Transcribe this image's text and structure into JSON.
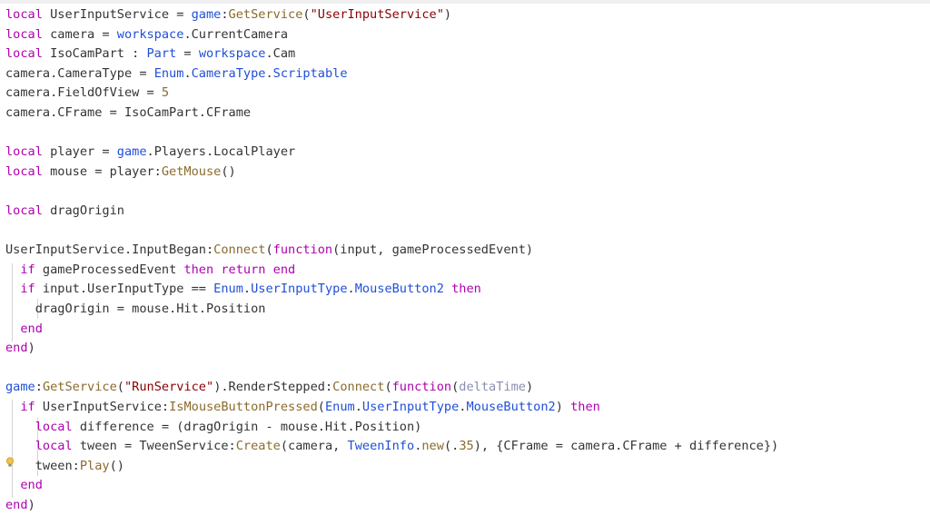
{
  "editor": {
    "language": "lua",
    "colors": {
      "keyword": "#b000b0",
      "builtin": "#1f4fd8",
      "method": "#8a6a2c",
      "string": "#8a0000",
      "number": "#8a6a2c",
      "param": "#8a8fb0",
      "plain": "#333333"
    },
    "lightbulb_icon": "lightbulb-icon",
    "lines": [
      [
        [
          "keyword",
          "local"
        ],
        [
          "plain",
          " UserInputService = "
        ],
        [
          "builtin",
          "game"
        ],
        [
          "plain",
          ":"
        ],
        [
          "method",
          "GetService"
        ],
        [
          "plain",
          "("
        ],
        [
          "string",
          "\"UserInputService\""
        ],
        [
          "plain",
          ")"
        ]
      ],
      [
        [
          "keyword",
          "local"
        ],
        [
          "plain",
          " camera = "
        ],
        [
          "builtin",
          "workspace"
        ],
        [
          "plain",
          ".CurrentCamera"
        ]
      ],
      [
        [
          "keyword",
          "local"
        ],
        [
          "plain",
          " IsoCamPart : "
        ],
        [
          "builtin",
          "Part"
        ],
        [
          "plain",
          " = "
        ],
        [
          "builtin",
          "workspace"
        ],
        [
          "plain",
          ".Cam"
        ]
      ],
      [
        [
          "plain",
          "camera.CameraType = "
        ],
        [
          "builtin",
          "Enum"
        ],
        [
          "plain",
          "."
        ],
        [
          "builtin",
          "CameraType"
        ],
        [
          "plain",
          "."
        ],
        [
          "builtin",
          "Scriptable"
        ]
      ],
      [
        [
          "plain",
          "camera.FieldOfView = "
        ],
        [
          "number",
          "5"
        ]
      ],
      [
        [
          "plain",
          "camera.CFrame = IsoCamPart.CFrame"
        ]
      ],
      [],
      [
        [
          "keyword",
          "local"
        ],
        [
          "plain",
          " player = "
        ],
        [
          "builtin",
          "game"
        ],
        [
          "plain",
          ".Players.LocalPlayer"
        ]
      ],
      [
        [
          "keyword",
          "local"
        ],
        [
          "plain",
          " mouse = player:"
        ],
        [
          "method",
          "GetMouse"
        ],
        [
          "plain",
          "()"
        ]
      ],
      [],
      [
        [
          "keyword",
          "local"
        ],
        [
          "plain",
          " dragOrigin"
        ]
      ],
      [],
      [
        [
          "plain",
          "UserInputService.InputBegan:"
        ],
        [
          "method",
          "Connect"
        ],
        [
          "plain",
          "("
        ],
        [
          "keyword",
          "function"
        ],
        [
          "plain",
          "(input, gameProcessedEvent)"
        ]
      ],
      [
        [
          "plain",
          "  "
        ],
        [
          "keyword",
          "if"
        ],
        [
          "plain",
          " gameProcessedEvent "
        ],
        [
          "keyword",
          "then"
        ],
        [
          "plain",
          " "
        ],
        [
          "keyword",
          "return"
        ],
        [
          "plain",
          " "
        ],
        [
          "keyword",
          "end"
        ]
      ],
      [
        [
          "plain",
          "  "
        ],
        [
          "keyword",
          "if"
        ],
        [
          "plain",
          " input.UserInputType == "
        ],
        [
          "builtin",
          "Enum"
        ],
        [
          "plain",
          "."
        ],
        [
          "builtin",
          "UserInputType"
        ],
        [
          "plain",
          "."
        ],
        [
          "builtin",
          "MouseButton2"
        ],
        [
          "plain",
          " "
        ],
        [
          "keyword",
          "then"
        ]
      ],
      [
        [
          "plain",
          "    dragOrigin = mouse.Hit.Position"
        ]
      ],
      [
        [
          "plain",
          "  "
        ],
        [
          "keyword",
          "end"
        ]
      ],
      [
        [
          "keyword",
          "end"
        ],
        [
          "plain",
          ")"
        ]
      ],
      [],
      [
        [
          "builtin",
          "game"
        ],
        [
          "plain",
          ":"
        ],
        [
          "method",
          "GetService"
        ],
        [
          "plain",
          "("
        ],
        [
          "string",
          "\"RunService\""
        ],
        [
          "plain",
          ").RenderStepped:"
        ],
        [
          "method",
          "Connect"
        ],
        [
          "plain",
          "("
        ],
        [
          "keyword",
          "function"
        ],
        [
          "plain",
          "("
        ],
        [
          "param",
          "deltaTime"
        ],
        [
          "plain",
          ")"
        ]
      ],
      [
        [
          "plain",
          "  "
        ],
        [
          "keyword",
          "if"
        ],
        [
          "plain",
          " UserInputService:"
        ],
        [
          "method",
          "IsMouseButtonPressed"
        ],
        [
          "plain",
          "("
        ],
        [
          "builtin",
          "Enum"
        ],
        [
          "plain",
          "."
        ],
        [
          "builtin",
          "UserInputType"
        ],
        [
          "plain",
          "."
        ],
        [
          "builtin",
          "MouseButton2"
        ],
        [
          "plain",
          ") "
        ],
        [
          "keyword",
          "then"
        ]
      ],
      [
        [
          "plain",
          "    "
        ],
        [
          "keyword",
          "local"
        ],
        [
          "plain",
          " difference = (dragOrigin - mouse.Hit.Position)"
        ]
      ],
      [
        [
          "plain",
          "    "
        ],
        [
          "keyword",
          "local"
        ],
        [
          "plain",
          " tween = TweenService:"
        ],
        [
          "method",
          "Create"
        ],
        [
          "plain",
          "(camera, "
        ],
        [
          "builtin",
          "TweenInfo"
        ],
        [
          "plain",
          "."
        ],
        [
          "method",
          "new"
        ],
        [
          "plain",
          "(."
        ],
        [
          "number",
          "35"
        ],
        [
          "plain",
          "), {CFrame = camera.CFrame + difference})"
        ]
      ],
      [
        [
          "plain",
          "    tween:"
        ],
        [
          "method",
          "Play"
        ],
        [
          "plain",
          "()"
        ]
      ],
      [
        [
          "plain",
          "  "
        ],
        [
          "keyword",
          "end"
        ]
      ],
      [
        [
          "keyword",
          "end"
        ],
        [
          "plain",
          ")"
        ]
      ]
    ]
  }
}
